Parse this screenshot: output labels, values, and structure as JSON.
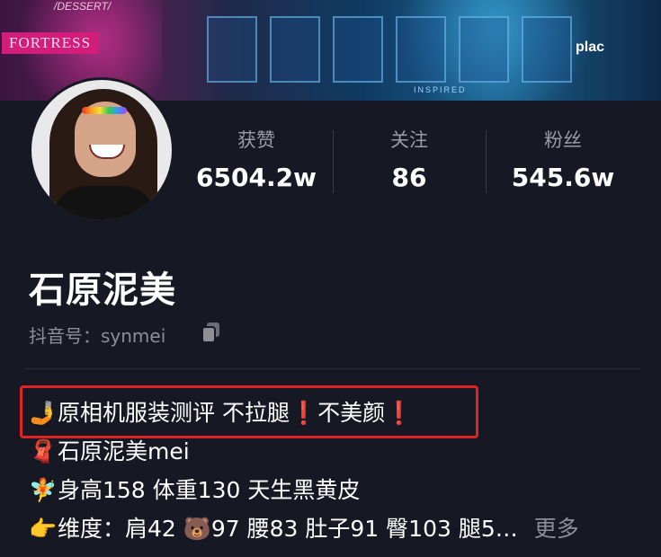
{
  "banner": {
    "sign_main": "FORTRESS",
    "sign_top": "/DESSERT/",
    "sign_right": "plac",
    "sign_bottom": "INSPIRED"
  },
  "stats": [
    {
      "label": "获赞",
      "value": "6504.2w"
    },
    {
      "label": "关注",
      "value": "86"
    },
    {
      "label": "粉丝",
      "value": "545.6w"
    }
  ],
  "profile": {
    "name": "石原泥美",
    "douyin_id": "抖音号：synmei"
  },
  "bio": [
    {
      "icon": "🤳",
      "text": "原相机服装测评 不拉腿❗不美颜❗"
    },
    {
      "icon": "🧣",
      "text": "石原泥美mei"
    },
    {
      "icon": "🧚",
      "text": "身高158 体重130  天生黑黄皮"
    },
    {
      "icon": "👉",
      "text": "维度：肩42 🐻97 腰83 肚子91 臀103 腿5…"
    }
  ],
  "more_label": "更多",
  "colors": {
    "highlight": "#e22323",
    "background": "#161823"
  }
}
